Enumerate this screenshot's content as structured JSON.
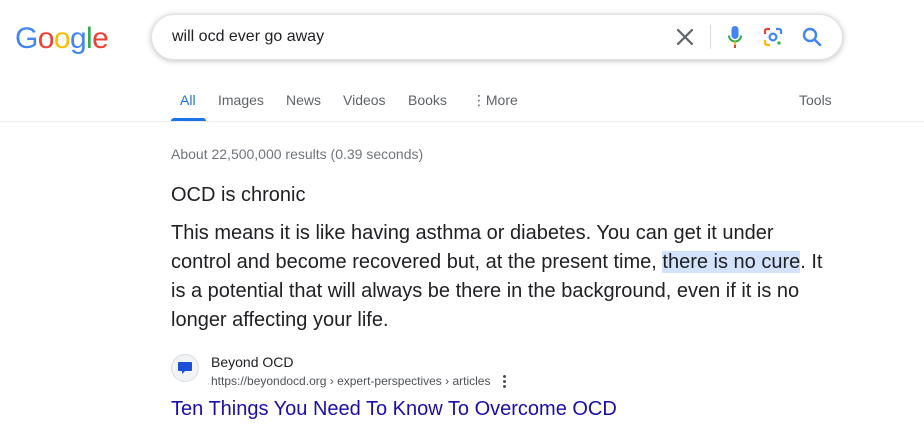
{
  "logo": {
    "letters": [
      "G",
      "o",
      "o",
      "g",
      "l",
      "e"
    ],
    "colors": [
      "#4285f4",
      "#ea4335",
      "#fbbc05",
      "#4285f4",
      "#34a853",
      "#ea4335"
    ]
  },
  "search": {
    "query": "will ocd ever go away",
    "icons": [
      "close-icon",
      "microphone-icon",
      "lens-icon",
      "search-icon"
    ]
  },
  "tabs": {
    "items": [
      {
        "label": "All",
        "active": true
      },
      {
        "label": "Images"
      },
      {
        "label": "News"
      },
      {
        "label": "Videos"
      },
      {
        "label": "Books"
      },
      {
        "label": "More"
      }
    ],
    "tools": "Tools"
  },
  "results_stats": "About 22,500,000 results (0.39 seconds)",
  "featured_snippet": {
    "title": "OCD is chronic",
    "text_before": "This means it is like having asthma or diabetes. You can get it under control and become recovered but, at the present time, ",
    "highlighted": "there is no cure",
    "text_after": ". It is a potential that will always be there in the background, even if it is no longer affecting your life."
  },
  "source": {
    "site_name": "Beyond OCD",
    "url": "https://beyondocd.org › expert-perspectives › articles",
    "title": "Ten Things You Need To Know To Overcome OCD"
  },
  "colors": {
    "accent": "#1a73e8",
    "link": "#1a0dab",
    "highlight": "#d3e3fd"
  }
}
